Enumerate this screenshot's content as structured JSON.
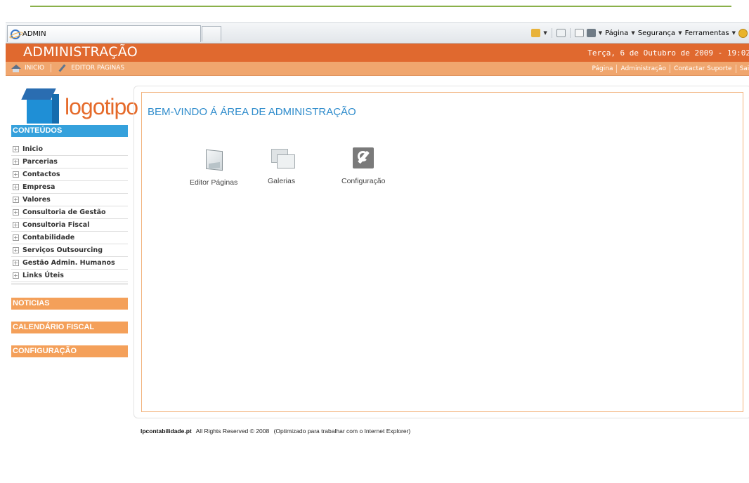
{
  "browser": {
    "tab_title": "ADMIN",
    "commands": {
      "page": "Página",
      "security": "Segurança",
      "tools": "Ferramentas"
    }
  },
  "header": {
    "title": "ADMINISTRAÇÃO",
    "date": "Terça, 6 de Outubro de 2009 - 19:02"
  },
  "subnav": {
    "left": [
      {
        "label": "INICIO",
        "icon": "home-icon"
      },
      {
        "label": "EDITOR PÁGINAS",
        "icon": "wrench-icon"
      }
    ],
    "right": [
      "Página",
      "Administração",
      "Contactar Suporte",
      "Sair"
    ]
  },
  "sidebar": {
    "logo_text": "logotipo",
    "contents_title": "CONTEÚDOS",
    "items": [
      {
        "label": "Inicio"
      },
      {
        "label": "Parcerias"
      },
      {
        "label": "Contactos"
      },
      {
        "label": "Empresa"
      },
      {
        "label": "Valores"
      },
      {
        "label": "Consultoria de Gestão"
      },
      {
        "label": "Consultoria Fiscal"
      },
      {
        "label": "Contabilidade"
      },
      {
        "label": "Serviços Outsourcing"
      },
      {
        "label": "Gestão Admin. Humanos"
      },
      {
        "label": "Links Úteis"
      }
    ],
    "sections": [
      "NOTICIAS",
      "CALENDÁRIO FISCAL",
      "CONFIGURAÇÃO"
    ]
  },
  "main": {
    "welcome": "BEM-VINDO Á ÁREA DE ADMINISTRAÇÃO",
    "tiles": [
      {
        "label": "Editor Páginas",
        "icon": "page-editor-icon"
      },
      {
        "label": "Galerias",
        "icon": "gallery-icon"
      },
      {
        "label": "Configuração",
        "icon": "wrench-icon"
      }
    ]
  },
  "footer": {
    "site": "lpcontabilidade.pt",
    "rights": "All Rights Reserved © 2008",
    "note": "(Optimizado para trabalhar com o Internet Explorer)"
  },
  "colors": {
    "header_orange": "#e0692f",
    "subnav_orange": "#f0a66e",
    "blue_heading": "#35a1dc",
    "welcome_blue": "#2f8ccc"
  }
}
